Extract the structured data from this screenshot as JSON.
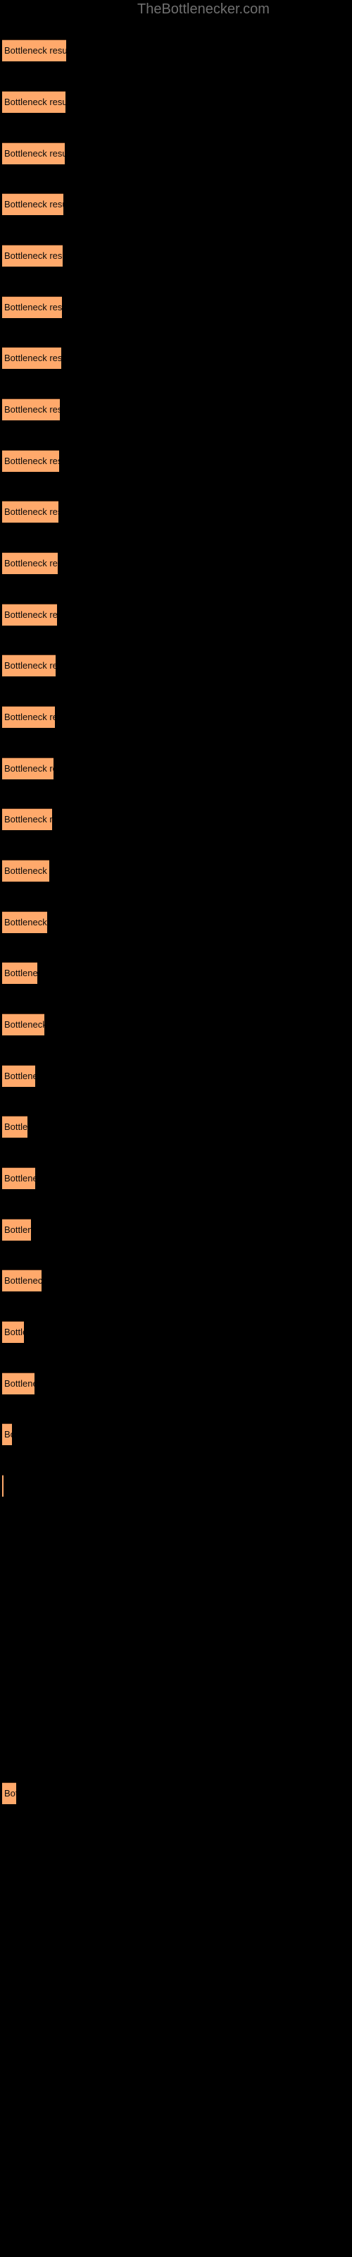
{
  "site": {
    "title": "TheBottlenecker.com"
  },
  "chart_data": {
    "type": "bar",
    "orientation": "horizontal",
    "title": "TheBottlenecker.com",
    "xlabel": "",
    "ylabel": "",
    "background_color": "#000000",
    "bar_color": "#ffa96b",
    "bar_border_color": "#512f18",
    "label_color": "#0a0a0a",
    "title_color": "#707070",
    "grid": false,
    "legend": false,
    "bar_label_text": "Bottleneck result",
    "categories": [
      "Bottleneck result",
      "Bottleneck result",
      "Bottleneck result",
      "Bottleneck result",
      "Bottleneck result",
      "Bottleneck result",
      "Bottleneck result",
      "Bottleneck result",
      "Bottleneck result",
      "Bottleneck result",
      "Bottleneck result",
      "Bottleneck result",
      "Bottleneck result",
      "Bottleneck result",
      "Bottleneck result",
      "Bottleneck result",
      "Bottleneck result",
      "Bottleneck result",
      "Bottleneck result",
      "Bottleneck result",
      "Bottleneck result",
      "Bottleneck result",
      "Bottleneck result",
      "Bottleneck result",
      "Bottleneck result",
      "Bottleneck result"
    ],
    "values": [
      91,
      90,
      89,
      87,
      86,
      85,
      84,
      82,
      81,
      80,
      79,
      78,
      76,
      67,
      50,
      64,
      47,
      36,
      56,
      39,
      53,
      31,
      52,
      14,
      2,
      17
    ],
    "xlim": [
      0,
      500
    ],
    "ylim": [
      0,
      26
    ]
  },
  "bars": [
    {
      "label": "Bottleneck result",
      "width": 91,
      "top": 56
    },
    {
      "label": "Bottleneck result",
      "width": 90,
      "top": 129
    },
    {
      "label": "Bottleneck result",
      "width": 89,
      "top": 202
    },
    {
      "label": "Bottleneck result",
      "width": 87,
      "top": 274
    },
    {
      "label": "Bottleneck result",
      "width": 86,
      "top": 347
    },
    {
      "label": "Bottleneck result",
      "width": 85,
      "top": 420
    },
    {
      "label": "Bottleneck result",
      "width": 84,
      "top": 492
    },
    {
      "label": "Bottleneck result",
      "width": 82,
      "top": 565
    },
    {
      "label": "Bottleneck result",
      "width": 81,
      "top": 638
    },
    {
      "label": "Bottleneck result",
      "width": 80,
      "top": 710
    },
    {
      "label": "Bottleneck result",
      "width": 79,
      "top": 783
    },
    {
      "label": "Bottleneck result",
      "width": 78,
      "top": 856
    },
    {
      "label": "Bottleneck result",
      "width": 76,
      "top": 928
    },
    {
      "label": "Bottleneck result",
      "width": 75,
      "top": 1001
    },
    {
      "label": "Bottleneck result",
      "width": 73,
      "top": 1074
    },
    {
      "label": "Bottleneck result",
      "width": 71,
      "top": 1146
    },
    {
      "label": "Bottleneck result",
      "width": 67,
      "top": 1219
    },
    {
      "label": "Bottleneck resu",
      "width": 64,
      "top": 1292
    },
    {
      "label": "Bottleneck",
      "width": 50,
      "top": 1364
    },
    {
      "label": "Bottleneck res",
      "width": 60,
      "top": 1437
    },
    {
      "label": "Bottlenec",
      "width": 47,
      "top": 1510
    },
    {
      "label": "Bottler",
      "width": 36,
      "top": 1582
    },
    {
      "label": "Bottlenec",
      "width": 47,
      "top": 1655
    },
    {
      "label": "Bottlene",
      "width": 41,
      "top": 1728
    },
    {
      "label": "Bottleneck r",
      "width": 56,
      "top": 1800
    },
    {
      "label": "Bottle",
      "width": 31,
      "top": 1873
    },
    {
      "label": "Bottlenec",
      "width": 46,
      "top": 1946
    },
    {
      "label": "B",
      "width": 14,
      "top": 2018
    },
    {
      "label": "",
      "width": 2,
      "top": 2091
    },
    {
      "label": "Bo",
      "width": 20,
      "top": 2527
    }
  ]
}
